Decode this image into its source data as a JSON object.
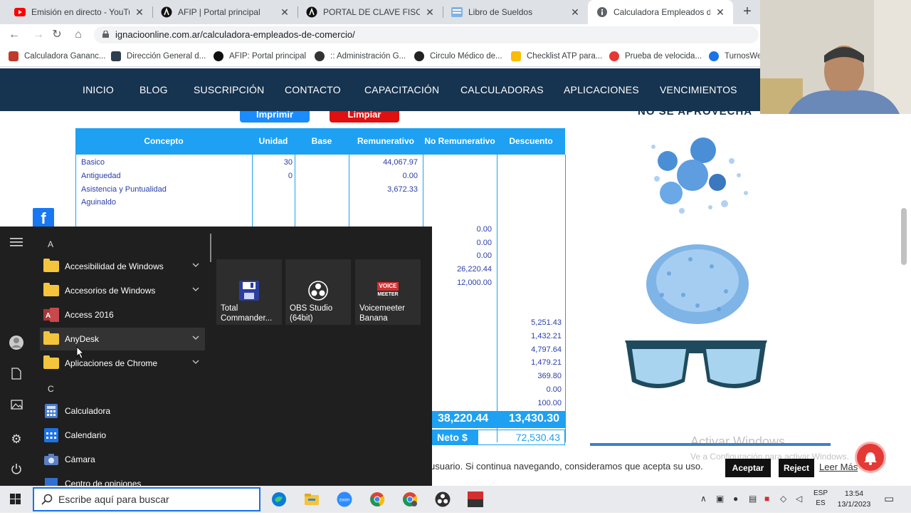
{
  "browser": {
    "tabs": [
      {
        "label": "Emisión en directo - YouTube",
        "icon": "youtube-icon",
        "active": false
      },
      {
        "label": "AFIP | Portal principal",
        "icon": "afip-icon",
        "active": false
      },
      {
        "label": "PORTAL DE CLAVE FISCAL",
        "icon": "afip-icon",
        "active": false
      },
      {
        "label": "Libro de Sueldos",
        "icon": "sheet-icon",
        "active": false
      },
      {
        "label": "Calculadora Empleados de Comercio",
        "icon": "info-icon",
        "active": true
      }
    ],
    "url": "ignacioonline.com.ar/calculadora-empleados-de-comercio/",
    "bookmarks": [
      {
        "label": "Calculadora Gananc...",
        "color": "#c0392b"
      },
      {
        "label": "Dirección General d...",
        "color": "#2c3e50"
      },
      {
        "label": "AFIP: Portal principal",
        "color": "#111111"
      },
      {
        "label": ":: Administración G...",
        "color": "#333333"
      },
      {
        "label": "Circulo Médico de...",
        "color": "#222222"
      },
      {
        "label": "Checklist ATP para...",
        "color": "#fbbc04"
      },
      {
        "label": "Prueba de velocida...",
        "color": "#e53935"
      },
      {
        "label": "TurnosWe",
        "color": "#1a73e8"
      }
    ]
  },
  "site": {
    "nav": [
      "INICIO",
      "BLOG",
      "SUSCRIPCIÓN",
      "CONTACTO",
      "CAPACITACIÓN",
      "CALCULADORAS",
      "APLICACIONES",
      "VENCIMIENTOS"
    ],
    "buttons": {
      "print": "Imprimir",
      "clear": "Limpiar"
    },
    "table": {
      "headers": [
        "Concepto",
        "Unidad",
        "Base",
        "Remunerativo",
        "No Remunerativo",
        "Descuento"
      ],
      "concepts": [
        "Basico",
        "Antiguedad",
        "Asistencia y Puntualidad",
        "Aguinaldo"
      ],
      "units": [
        "30",
        "0"
      ],
      "remunerativo": [
        "44,067.97",
        "0.00",
        "3,672.33"
      ],
      "no_remunerativo": [
        "0.00",
        "0.00",
        "0.00",
        "26,220.44",
        "12,000.00"
      ],
      "descuento": [
        "5,251.43",
        "1,432.21",
        "4,797.64",
        "1,479.21",
        "369.80",
        "0.00",
        "100.00"
      ],
      "totals": {
        "no_remunerativo": "38,220.44",
        "descuento": "13,430.30"
      },
      "neto": {
        "label": "Neto $",
        "value": "72,530.43"
      }
    },
    "side_heading": "NO SE APROVECHA",
    "cookie": {
      "text": "usuario. Si continua navegando, consideramos que acepta su uso.",
      "accept": "Aceptar",
      "reject": "Reject",
      "more": "Leer Más"
    },
    "watermark": {
      "title": "Activar Windows",
      "subtitle": "Ve a Configuración para activar Windows."
    }
  },
  "start_menu": {
    "sections": [
      {
        "letter": "A",
        "items": [
          {
            "label": "Accesibilidad de Windows",
            "type": "folder",
            "expandable": true
          },
          {
            "label": "Accesorios de Windows",
            "type": "folder",
            "expandable": true
          },
          {
            "label": "Access 2016",
            "type": "access",
            "expandable": false
          },
          {
            "label": "AnyDesk",
            "type": "folder",
            "expandable": true
          },
          {
            "label": "Aplicaciones de Chrome",
            "type": "folder",
            "expandable": true
          }
        ]
      },
      {
        "letter": "C",
        "items": [
          {
            "label": "Calculadora",
            "type": "calculator",
            "expandable": false
          },
          {
            "label": "Calendario",
            "type": "calendar",
            "expandable": false
          },
          {
            "label": "Cámara",
            "type": "camera",
            "expandable": false
          },
          {
            "label": "Centro de opiniones",
            "type": "feedback",
            "expandable": false
          }
        ]
      }
    ],
    "tiles": [
      {
        "label": "Total Commander...",
        "icon": "floppy-icon"
      },
      {
        "label": "OBS Studio (64bit)",
        "icon": "obs-icon"
      },
      {
        "label": "Voicemeeter Banana",
        "icon": "voicemeeter-icon",
        "badge_top": "VOICE",
        "badge_bottom": "MEETER"
      }
    ]
  },
  "taskbar": {
    "search_placeholder": "Escribe aquí para buscar",
    "lang_top": "ESP",
    "lang_bottom": "ES",
    "time": "13:54",
    "date": "13/1/2023",
    "apps": [
      "edge-icon",
      "explorer-icon",
      "zoom-icon",
      "chrome-icon",
      "chrome-profile-icon",
      "obs-icon",
      "voicemeeter-icon"
    ]
  }
}
